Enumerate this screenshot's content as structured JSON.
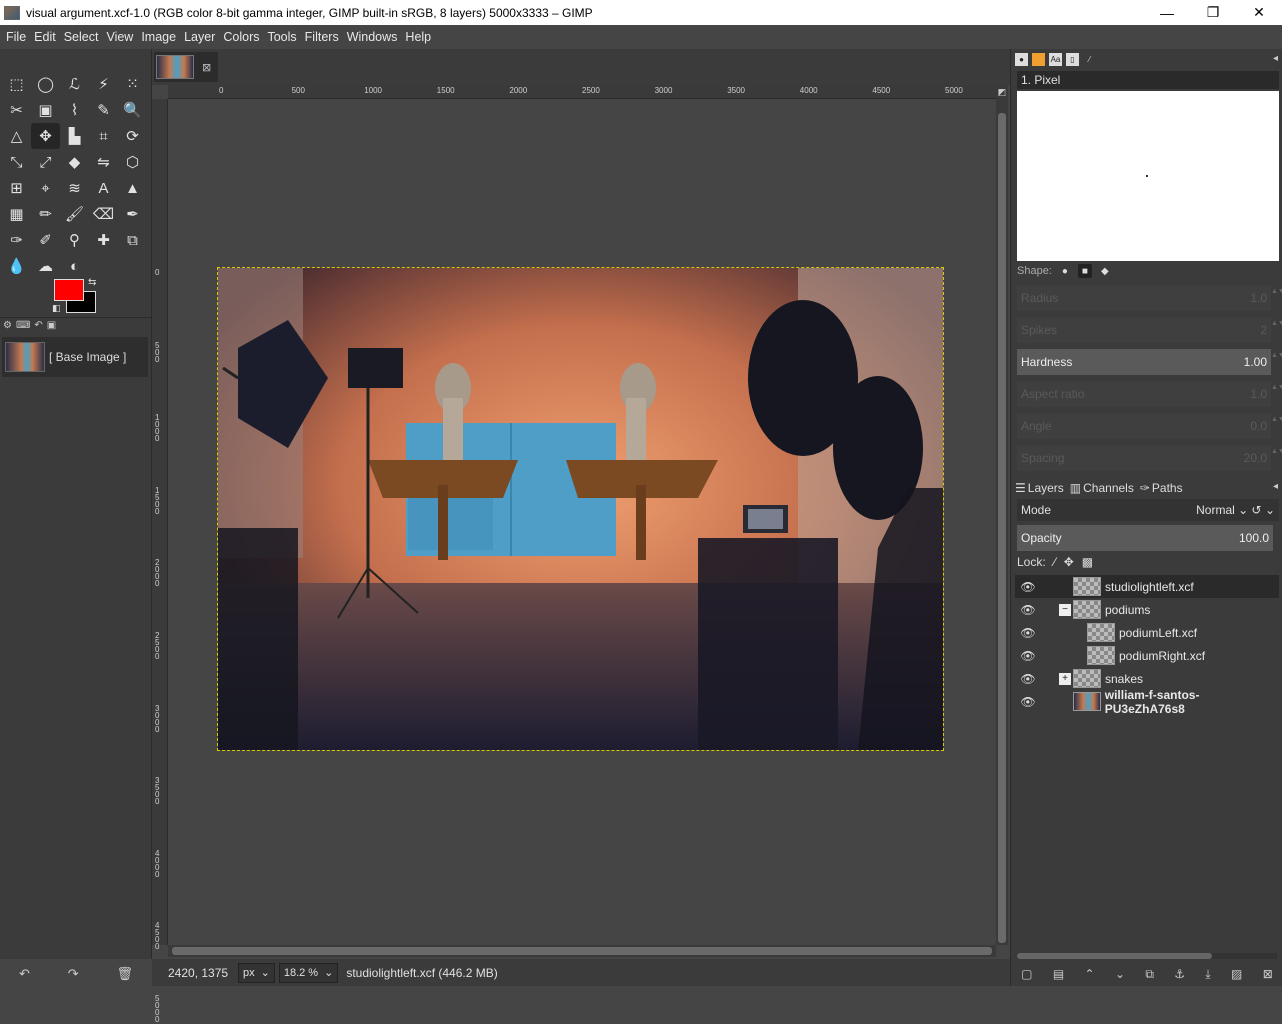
{
  "window": {
    "title": "visual argument.xcf-1.0 (RGB color 8-bit gamma integer, GIMP built-in sRGB, 8 layers) 5000x3333 – GIMP",
    "minimize": "—",
    "maximize": "❐",
    "close": "✕"
  },
  "menu": [
    "File",
    "Edit",
    "Select",
    "View",
    "Image",
    "Layer",
    "Colors",
    "Tools",
    "Filters",
    "Windows",
    "Help"
  ],
  "toolbox": {
    "tools": [
      {
        "name": "rect-select-icon",
        "glyph": "⬚"
      },
      {
        "name": "ellipse-select-icon",
        "glyph": "◯"
      },
      {
        "name": "free-select-icon",
        "glyph": "ℒ"
      },
      {
        "name": "fuzzy-select-icon",
        "glyph": "⚡"
      },
      {
        "name": "color-select-icon",
        "glyph": "⁙"
      },
      {
        "name": "scissors-icon",
        "glyph": "✂"
      },
      {
        "name": "foreground-select-icon",
        "glyph": "▣"
      },
      {
        "name": "paths-icon",
        "glyph": "⌇"
      },
      {
        "name": "color-picker-icon",
        "glyph": "✎"
      },
      {
        "name": "zoom-icon",
        "glyph": "🔍"
      },
      {
        "name": "measure-icon",
        "glyph": "△"
      },
      {
        "name": "move-icon",
        "glyph": "✥"
      },
      {
        "name": "align-icon",
        "glyph": "▙"
      },
      {
        "name": "crop-icon",
        "glyph": "⌗"
      },
      {
        "name": "rotate-icon",
        "glyph": "⟳"
      },
      {
        "name": "scale-icon",
        "glyph": "⤡"
      },
      {
        "name": "shear-icon",
        "glyph": "⤢"
      },
      {
        "name": "perspective-icon",
        "glyph": "◆"
      },
      {
        "name": "flip-icon",
        "glyph": "⇋"
      },
      {
        "name": "cage-icon",
        "glyph": "⬡"
      },
      {
        "name": "unified-transform-icon",
        "glyph": "⊞"
      },
      {
        "name": "handle-transform-icon",
        "glyph": "⌖"
      },
      {
        "name": "warp-icon",
        "glyph": "≋"
      },
      {
        "name": "text-icon",
        "glyph": "A"
      },
      {
        "name": "bucket-fill-icon",
        "glyph": "▲"
      },
      {
        "name": "gradient-icon",
        "glyph": "▦"
      },
      {
        "name": "pencil-icon",
        "glyph": "✏"
      },
      {
        "name": "paintbrush-icon",
        "glyph": "🖌"
      },
      {
        "name": "eraser-icon",
        "glyph": "⌫"
      },
      {
        "name": "airbrush-icon",
        "glyph": "✒"
      },
      {
        "name": "ink-icon",
        "glyph": "✑"
      },
      {
        "name": "mypaint-brush-icon",
        "glyph": "✐"
      },
      {
        "name": "clone-icon",
        "glyph": "⚲"
      },
      {
        "name": "heal-icon",
        "glyph": "✚"
      },
      {
        "name": "perspective-clone-icon",
        "glyph": "⧉"
      },
      {
        "name": "blur-icon",
        "glyph": "💧"
      },
      {
        "name": "smudge-icon",
        "glyph": "☁"
      },
      {
        "name": "dodge-burn-icon",
        "glyph": "◐"
      }
    ],
    "active_index": 11,
    "fg_color": "#ff0000",
    "bg_color": "#000000"
  },
  "images_panel": {
    "item_label": "[ Base Image ]"
  },
  "rulers": {
    "h_labels": [
      "0",
      "500",
      "1000",
      "1500",
      "2000",
      "2500",
      "3000",
      "3500",
      "4000",
      "4500",
      "5000"
    ],
    "v_labels": [
      "0",
      "500",
      "1000",
      "1500",
      "2000",
      "2500",
      "3000",
      "3500",
      "4000",
      "4500",
      "5000"
    ]
  },
  "status": {
    "coords": "2420, 1375",
    "unit": "px",
    "zoom": "18.2 %",
    "message": "studiolightleft.xcf (446.2 MB)"
  },
  "brushes": {
    "selected": "1. Pixel",
    "shape_label": "Shape:",
    "params": [
      {
        "label": "Radius",
        "value": "1.0",
        "active": false
      },
      {
        "label": "Spikes",
        "value": "2",
        "active": false
      },
      {
        "label": "Hardness",
        "value": "1.00",
        "active": true
      },
      {
        "label": "Aspect ratio",
        "value": "1.0",
        "active": false
      },
      {
        "label": "Angle",
        "value": "0.0",
        "active": false
      },
      {
        "label": "Spacing",
        "value": "20.0",
        "active": false
      }
    ]
  },
  "layers": {
    "tabs": [
      "Layers",
      "Channels",
      "Paths"
    ],
    "mode_label": "Mode",
    "mode_value": "Normal",
    "opacity_label": "Opacity",
    "opacity_value": "100.0",
    "lock_label": "Lock:",
    "items": [
      {
        "name": "studiolightleft.xcf",
        "indent": 0,
        "expander": "",
        "selected": true,
        "photo": false,
        "bold": false
      },
      {
        "name": "podiums",
        "indent": 0,
        "expander": "−",
        "selected": false,
        "photo": false,
        "bold": false
      },
      {
        "name": "podiumLeft.xcf",
        "indent": 1,
        "expander": "",
        "selected": false,
        "photo": false,
        "bold": false
      },
      {
        "name": "podiumRight.xcf",
        "indent": 1,
        "expander": "",
        "selected": false,
        "photo": false,
        "bold": false
      },
      {
        "name": "snakes",
        "indent": 0,
        "expander": "+",
        "selected": false,
        "photo": false,
        "bold": false
      },
      {
        "name": "william-f-santos-PU3eZhA76s8",
        "indent": 0,
        "expander": "",
        "selected": false,
        "photo": true,
        "bold": true
      }
    ]
  }
}
